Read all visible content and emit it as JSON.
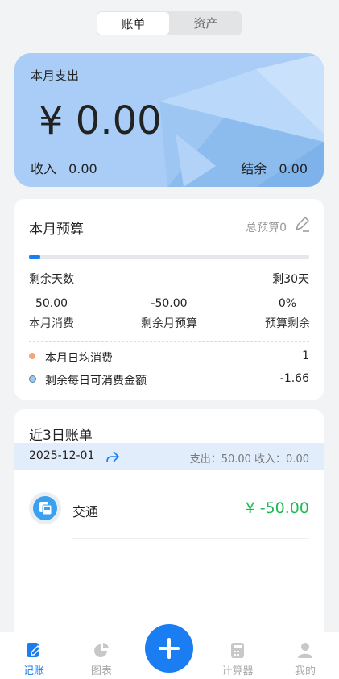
{
  "segment": {
    "items": [
      "账单",
      "资产"
    ],
    "active": 0
  },
  "hero": {
    "label": "本月支出",
    "amount": "¥ 0.00",
    "income_label": "收入",
    "income_value": "0.00",
    "balance_label": "结余",
    "balance_value": "0.00"
  },
  "budget": {
    "title": "本月预算",
    "total": "总预算0",
    "progress": 0.04,
    "days_label": "剩余天数",
    "days_value": "剩30天",
    "stats": [
      {
        "value": "50.00",
        "label": "本月消费"
      },
      {
        "value": "-50.00",
        "label": "剩余月预算"
      },
      {
        "value": "0%",
        "label": "预算剩余"
      }
    ],
    "avg_label": "本月日均消费",
    "avg_value": "1",
    "remain_label": "剩余每日可消费金额",
    "remain_value": "-1.66",
    "colors": {
      "avg_dot": "#f6a47a",
      "remain_dot": "#9cc7ee"
    }
  },
  "bills": {
    "title": "近3日账单",
    "date": "2025-12-01",
    "summary": "支出：50.00   收入：0.00",
    "items": [
      {
        "icon": "bus-icon",
        "name": "交通",
        "amount": "¥ -50.00"
      }
    ]
  },
  "tabs": [
    {
      "label": "记账",
      "icon": "ledger-icon",
      "active": true
    },
    {
      "label": "图表",
      "icon": "pie-chart-icon",
      "active": false
    },
    {
      "label": "计算器",
      "icon": "calculator-icon",
      "active": false
    },
    {
      "label": "我的",
      "icon": "user-icon",
      "active": false
    }
  ],
  "colors": {
    "accent": "#1a7ef2",
    "income_green": "#1db954"
  }
}
